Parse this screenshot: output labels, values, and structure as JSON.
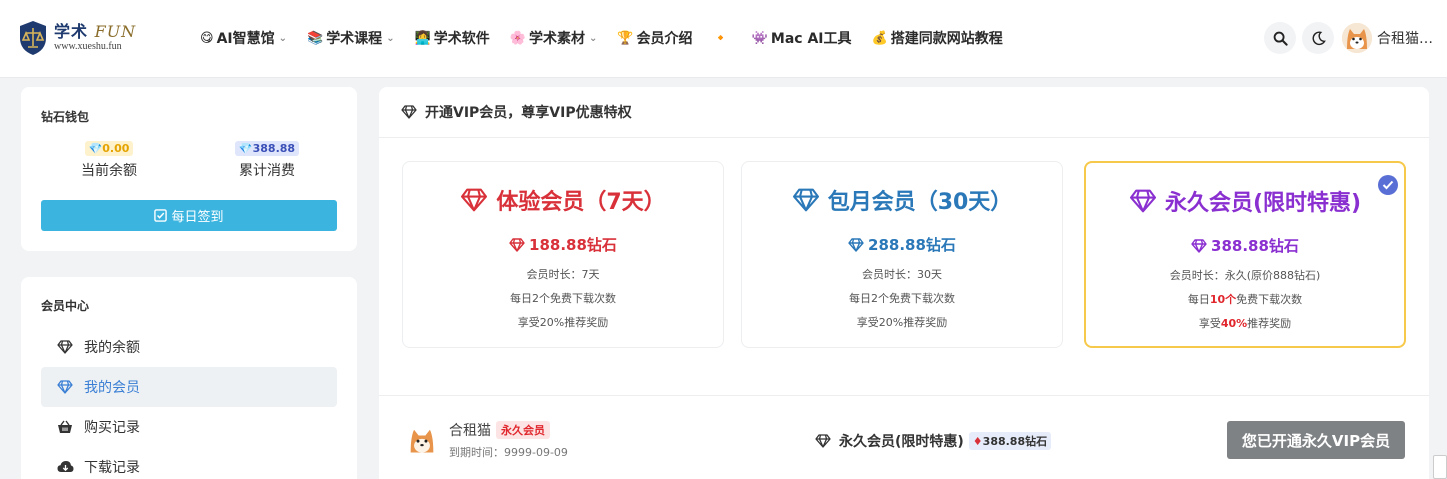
{
  "header": {
    "logo": {
      "name": "学术",
      "fun": "FUN",
      "url": "www.xueshu.fun"
    },
    "nav": [
      {
        "label": "AI智慧馆",
        "icon": "😋",
        "has_dropdown": true
      },
      {
        "label": "学术课程",
        "icon": "📚",
        "has_dropdown": true
      },
      {
        "label": "学术软件",
        "icon": "👩‍💻",
        "has_dropdown": false
      },
      {
        "label": "学术素材",
        "icon": "🌸",
        "has_dropdown": true
      },
      {
        "label": "会员介绍",
        "icon": "🏆",
        "has_dropdown": false
      },
      {
        "label": "",
        "icon": "🔸",
        "has_dropdown": false
      },
      {
        "label": "Mac AI工具",
        "icon": "👾",
        "has_dropdown": false
      },
      {
        "label": "搭建同款网站教程",
        "icon": "💰",
        "has_dropdown": false
      }
    ],
    "username": "合租猫…"
  },
  "wallet": {
    "title": "钻石钱包",
    "balance": {
      "value": "0.00",
      "label": "当前余额"
    },
    "spent": {
      "value": "388.88",
      "label": "累计消费"
    },
    "signin_label": "每日签到"
  },
  "member_center": {
    "title": "会员中心",
    "items": [
      {
        "label": "我的余额",
        "icon": "diamond-icon",
        "active": false
      },
      {
        "label": "我的会员",
        "icon": "diamond-icon",
        "active": true
      },
      {
        "label": "购买记录",
        "icon": "basket-icon",
        "active": false
      },
      {
        "label": "下载记录",
        "icon": "cloud-download-icon",
        "active": false
      }
    ]
  },
  "vip": {
    "heading": "开通VIP会员，尊享VIP优惠特权",
    "plans": [
      {
        "title": "体验会员（7天）",
        "price": "188.88钻石",
        "color": "#d9313a",
        "line1": "会员时长：7天",
        "line2_pre": "每日2个免费下载次数",
        "line2_hl": "",
        "line2_post": "",
        "line3_pre": "享受20%推荐奖励",
        "line3_hl": "",
        "line3_post": "",
        "selected": false
      },
      {
        "title": "包月会员（30天）",
        "price": "288.88钻石",
        "color": "#2a78b8",
        "line1": "会员时长：30天",
        "line2_pre": "每日2个免费下载次数",
        "line2_hl": "",
        "line2_post": "",
        "line3_pre": "享受20%推荐奖励",
        "line3_hl": "",
        "line3_post": "",
        "selected": false
      },
      {
        "title": "永久会员(限时特惠)",
        "price": "388.88钻石",
        "color": "#8a2fd0",
        "line1": "会员时长：永久(原价888钻石)",
        "line2_pre": "每日",
        "line2_hl": "10个",
        "line2_post": "免费下载次数",
        "line3_pre": "享受",
        "line3_hl": "40%",
        "line3_post": "推荐奖励",
        "selected": true
      }
    ]
  },
  "current": {
    "username": "合租猫",
    "tag": "永久会员",
    "expire": "到期时间：9999-09-09",
    "plan": "永久会员(限时特惠)",
    "plan_price": "388.88钻石",
    "button": "您已开通永久VIP会员"
  }
}
